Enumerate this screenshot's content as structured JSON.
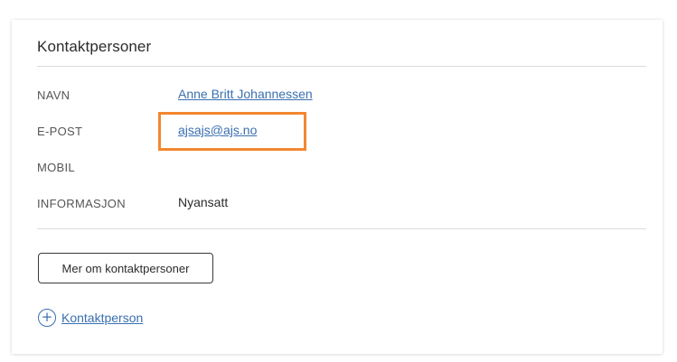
{
  "section": {
    "title": "Kontaktpersoner"
  },
  "contact": {
    "name_label": "NAVN",
    "name_value": "Anne Britt Johannessen",
    "email_label": "E-POST",
    "email_value": "ajsajs@ajs.no",
    "mobile_label": "MOBIL",
    "mobile_value": "",
    "info_label": "INFORMASJON",
    "info_value": "Nyansatt"
  },
  "actions": {
    "more_button_label": "Mer om kontaktpersoner",
    "add_contact_label": "Kontaktperson",
    "add_icon": "plus-circle-icon"
  },
  "colors": {
    "link": "#3a6fb0",
    "highlight": "#f3872f"
  }
}
